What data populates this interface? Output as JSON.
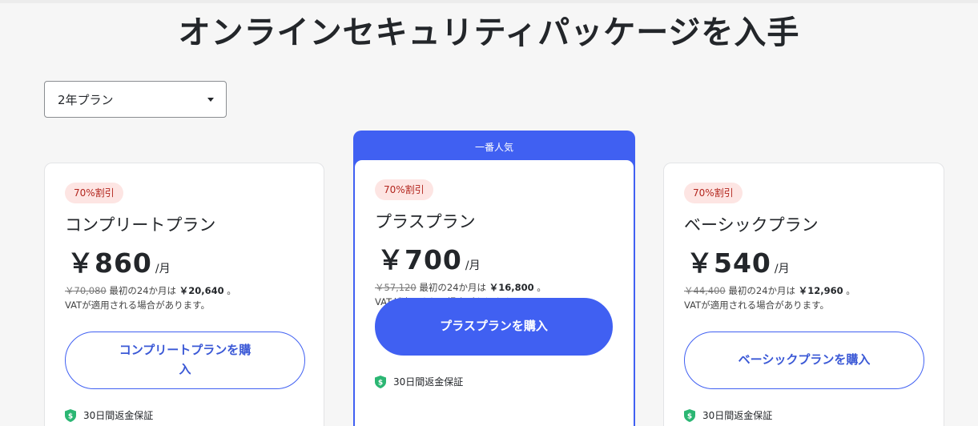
{
  "page": {
    "title": "オンラインセキュリティパッケージを入手"
  },
  "plan_select": {
    "value": "2年プラン"
  },
  "popular_label": "一番人気",
  "plans": [
    {
      "discount": "70%割引",
      "name": "コンプリートプラン",
      "price": "￥860",
      "unit": "/月",
      "old_total": "￥70,080",
      "first_period": "最初の24か月は",
      "first_total": "￥20,640",
      "period_end": "。",
      "vat_note": "VATが適用される場合があります。",
      "button": "コンプリートプランを購入",
      "guarantee": "30日間返金保証"
    },
    {
      "discount": "70%割引",
      "name": "プラスプラン",
      "price": "￥700",
      "unit": "/月",
      "old_total": "￥57,120",
      "first_period": "最初の24か月は",
      "first_total": "￥16,800",
      "period_end": "。",
      "vat_note": "VATが適用される場合があります。",
      "button": "プラスプランを購入",
      "guarantee": "30日間返金保証"
    },
    {
      "discount": "70%割引",
      "name": "ベーシックプラン",
      "price": "￥540",
      "unit": "/月",
      "old_total": "￥44,400",
      "first_period": "最初の24か月は",
      "first_total": "￥12,960",
      "period_end": "。",
      "vat_note": "VATが適用される場合があります。",
      "button": "ベーシックプランを購入",
      "guarantee": "30日間返金保証"
    }
  ],
  "colors": {
    "accent": "#4060f2",
    "badge_bg": "#fde5e3",
    "badge_text": "#b3261e",
    "shield": "#2bb673"
  },
  "icons": {
    "dropdown": "chevron-down-icon",
    "guarantee": "shield-dollar-icon"
  }
}
